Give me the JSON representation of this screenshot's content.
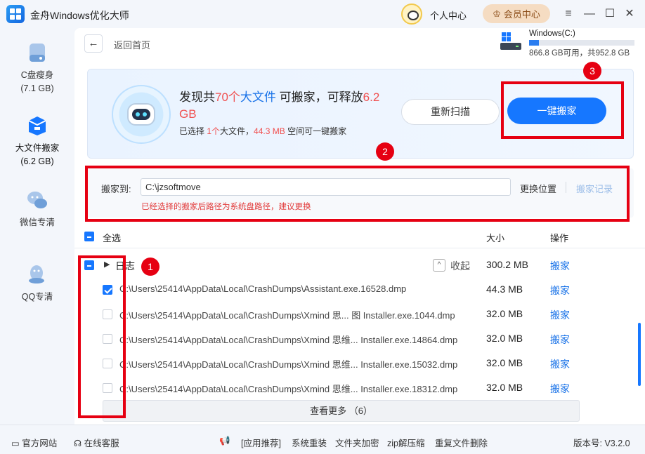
{
  "app": {
    "title": "金舟Windows优化大师"
  },
  "header": {
    "personal_center": "个人中心",
    "vip_center": "会员中心"
  },
  "sidebar": {
    "items": [
      {
        "label": "C盘瘦身",
        "sub": "(7.1 GB)"
      },
      {
        "label": "大文件搬家",
        "sub": "(6.2 GB)"
      },
      {
        "label": "微信专清",
        "sub": ""
      },
      {
        "label": "QQ专清",
        "sub": ""
      }
    ]
  },
  "nav": {
    "back_label": "返回首页"
  },
  "disk": {
    "name": "Windows(C:)",
    "info": "866.8 GB可用，共952.8 GB",
    "used_fraction": 0.09
  },
  "banner": {
    "found_prefix": "发现共",
    "count": "70个",
    "big_file": "大文件",
    "mid_text": " 可搬家，可释放",
    "size": "6.2 GB",
    "selected_prefix": "已选择 ",
    "selected_count": "1个",
    "selected_mid": "大文件，",
    "selected_size": "44.3 MB",
    "selected_suffix": " 空间可一键搬家",
    "rescan": "重新扫描",
    "one_click_move": "一键搬家"
  },
  "path": {
    "label": "搬家到:",
    "value": "C:\\jzsoftmove",
    "change": "更换位置",
    "history": "搬家记录",
    "warning": "已经选择的搬家后路径为系统盘路径，建议更换"
  },
  "table": {
    "select_all": "全选",
    "col_size": "大小",
    "col_action": "操作",
    "group": {
      "name": "日志",
      "collapse": "收起",
      "size": "300.2 MB",
      "action": "搬家"
    },
    "rows": [
      {
        "path": "C:\\Users\\25414\\AppData\\Local\\CrashDumps\\Assistant.exe.16528.dmp",
        "size": "44.3 MB",
        "action": "搬家",
        "checked": true
      },
      {
        "path": "C:\\Users\\25414\\AppData\\Local\\CrashDumps\\Xmind 思... 图 Installer.exe.1044.dmp",
        "size": "32.0 MB",
        "action": "搬家",
        "checked": false
      },
      {
        "path": "C:\\Users\\25414\\AppData\\Local\\CrashDumps\\Xmind 思维... Installer.exe.14864.dmp",
        "size": "32.0 MB",
        "action": "搬家",
        "checked": false
      },
      {
        "path": "C:\\Users\\25414\\AppData\\Local\\CrashDumps\\Xmind 思维... Installer.exe.15032.dmp",
        "size": "32.0 MB",
        "action": "搬家",
        "checked": false
      },
      {
        "path": "C:\\Users\\25414\\AppData\\Local\\CrashDumps\\Xmind 思维... Installer.exe.18312.dmp",
        "size": "32.0 MB",
        "action": "搬家",
        "checked": false
      }
    ],
    "more": "查看更多 （6）"
  },
  "annotations": {
    "n1": "1",
    "n2": "2",
    "n3": "3"
  },
  "statusbar": {
    "website": "官方网站",
    "support": "在线客服",
    "recommend": "[应用推荐]",
    "reinstall": "系统重装",
    "encrypt": "文件夹加密",
    "zip": "zip解压缩",
    "dedupe": "重复文件删除",
    "version": "版本号: V3.2.0"
  },
  "colors": {
    "accent": "#1677ff",
    "annotation": "#e60012",
    "warning": "#e23b3b"
  }
}
